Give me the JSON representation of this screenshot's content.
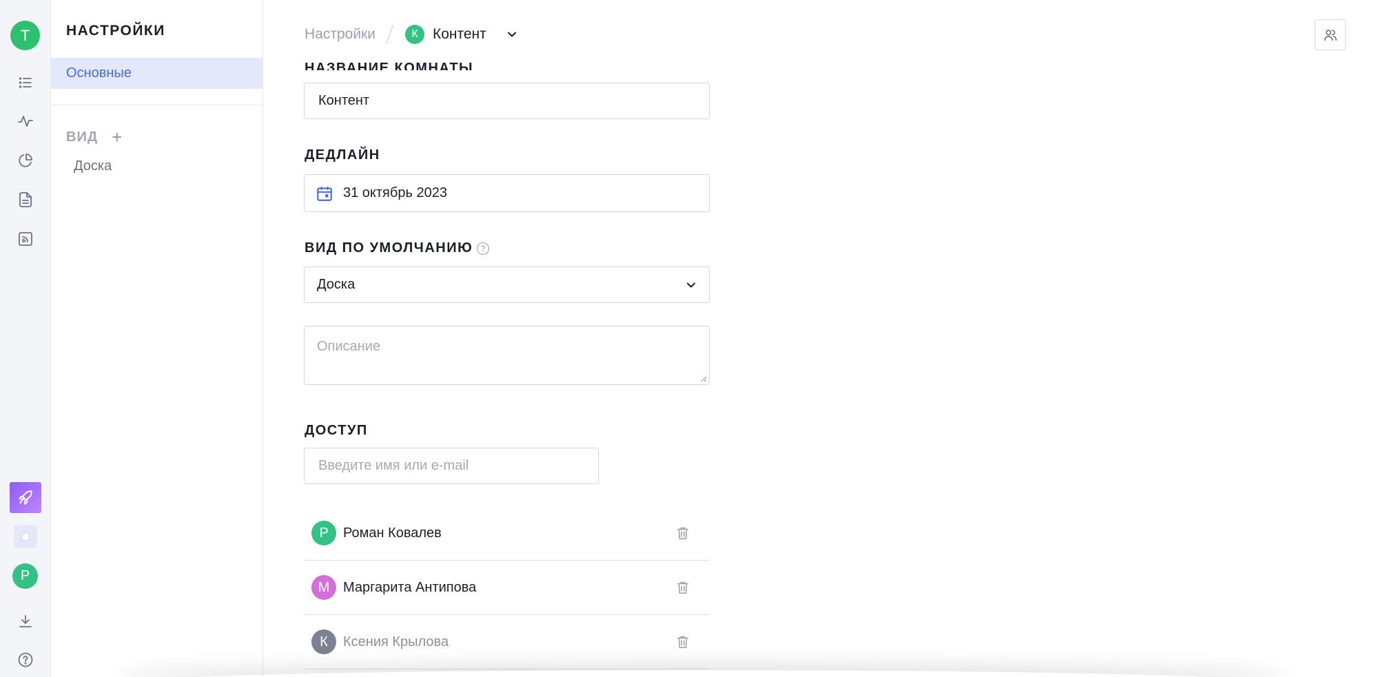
{
  "rail": {
    "workspace_initial": "Т",
    "user_initial": "Р",
    "icons": [
      "list-icon",
      "activity-icon",
      "pie-chart-icon",
      "document-icon",
      "feed-icon",
      "rocket-icon",
      "bell-icon",
      "download-icon",
      "help-icon"
    ]
  },
  "sidebar": {
    "title": "НАСТРОЙКИ",
    "active_item": "Основные",
    "view_heading": "ВИД",
    "view_add": "+",
    "view_items": [
      "Доска"
    ]
  },
  "header": {
    "breadcrumb_root": "Настройки",
    "room_initial": "К",
    "room_name": "Контент"
  },
  "form": {
    "room_name_label": "НАЗВАНИЕ КОМНАТЫ",
    "room_name_value": "Контент",
    "deadline_label": "ДЕДЛАЙН",
    "deadline_value": "31 октябрь 2023",
    "default_view_label": "ВИД ПО УМОЛЧАНИЮ",
    "default_view_help": "?",
    "default_view_value": "Доска",
    "description_placeholder": "Описание",
    "access_label": "ДОСТУП",
    "access_placeholder": "Введите имя или e-mail"
  },
  "members": [
    {
      "initial": "Р",
      "name": "Роман Ковалев",
      "color": "#34c186"
    },
    {
      "initial": "М",
      "name": "Маргарита Антипова",
      "color": "#d46fd9"
    },
    {
      "initial": "К",
      "name": "Ксения Крылова",
      "color": "#7c8292"
    }
  ],
  "colors": {
    "accent": "#4a6bd6",
    "active_bg": "#e3e8fb",
    "green": "#2fbf71"
  }
}
